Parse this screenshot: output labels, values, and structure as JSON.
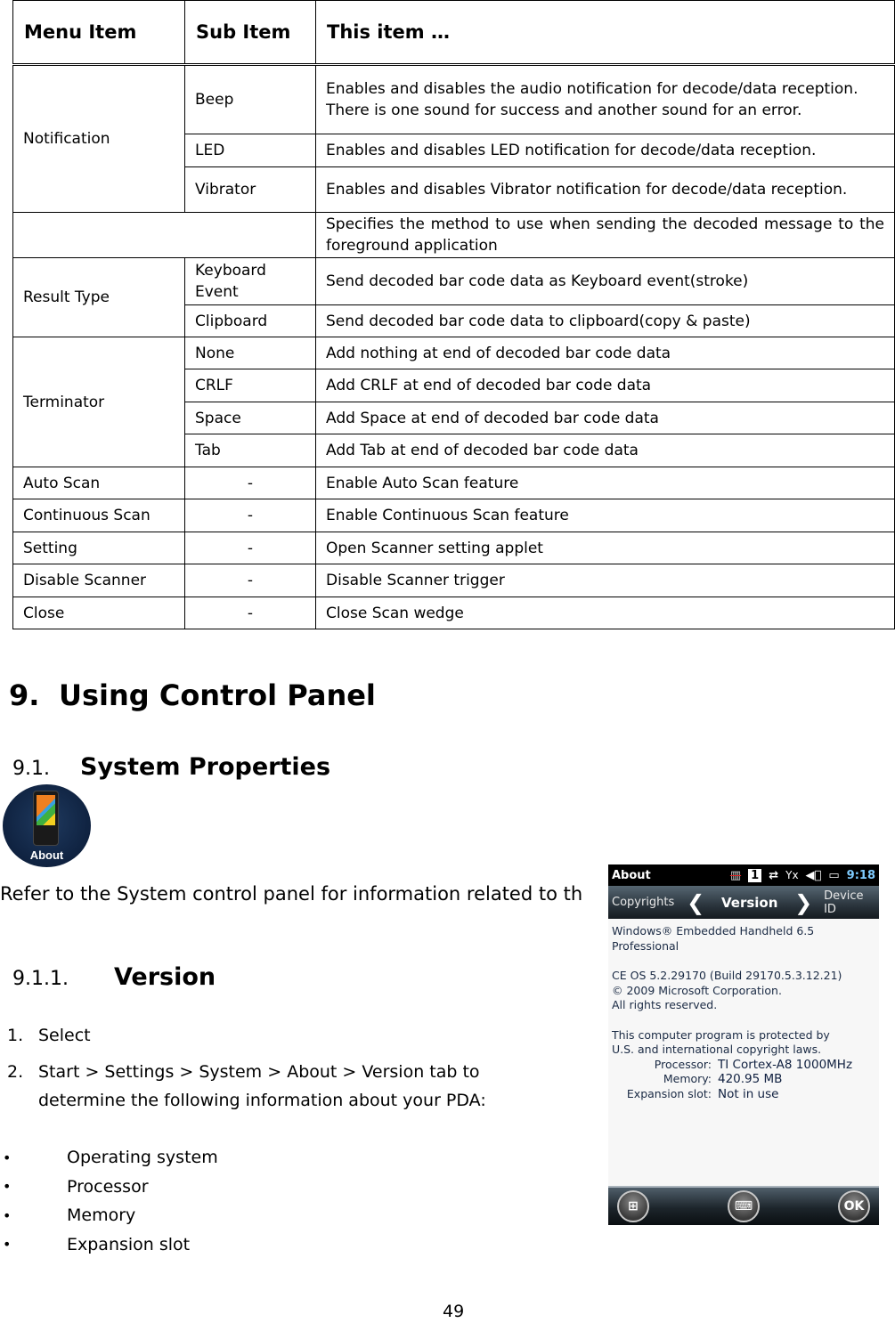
{
  "table": {
    "headers": [
      "Menu Item",
      "Sub Item",
      "This item …"
    ],
    "notification": {
      "menu": "Notification",
      "rows": [
        {
          "sub": "Beep",
          "desc": "Enables and disables the audio notification for decode/data reception. There is one sound for success and another sound for an error."
        },
        {
          "sub": "LED",
          "desc": "Enables and disables LED notification for decode/data reception."
        },
        {
          "sub": "Vibrator",
          "desc": "Enables and disables Vibrator notification for decode/data reception."
        }
      ]
    },
    "result_type_intro": "Specifies the method to use when sending the decoded message to the foreground application",
    "result_type": {
      "menu": "Result Type",
      "rows": [
        {
          "sub": "Keyboard Event",
          "desc": "Send decoded bar code data as Keyboard event(stroke)"
        },
        {
          "sub": "Clipboard",
          "desc": "Send decoded bar code data to clipboard(copy & paste)"
        }
      ]
    },
    "terminator": {
      "menu": "Terminator",
      "rows": [
        {
          "sub": "None",
          "desc": "Add nothing at end of decoded bar code data"
        },
        {
          "sub": "CRLF",
          "desc": "Add CRLF at end of decoded bar code data"
        },
        {
          "sub": "Space",
          "desc": "Add Space at end of decoded bar code data"
        },
        {
          "sub": "Tab",
          "desc": "Add Tab at end of decoded bar code data"
        }
      ]
    },
    "simple_rows": [
      {
        "menu": "Auto Scan",
        "sub": "-",
        "desc": "Enable Auto Scan feature"
      },
      {
        "menu": "Continuous Scan",
        "sub": "-",
        "desc": "Enable Continuous Scan feature"
      },
      {
        "menu": "Setting",
        "sub": "-",
        "desc": "Open Scanner setting applet"
      },
      {
        "menu": "Disable Scanner",
        "sub": "-",
        "desc": "Disable Scanner trigger"
      },
      {
        "menu": "Close",
        "sub": "-",
        "desc": "Close Scan wedge"
      }
    ]
  },
  "section": {
    "h1_num": "9.",
    "h1_title": "Using Control Panel",
    "h2_num": "9.1.",
    "h2_title": "System Properties",
    "about_icon_label": "About",
    "intro": "Refer to the System control panel for information related to th",
    "h3_num": "9.1.1.",
    "h3_title": "Version",
    "steps": [
      {
        "num": "1.",
        "text": "Select"
      },
      {
        "num": "2.",
        "text": "Start > Settings > System > About > Version tab to determine the following information about your PDA:"
      }
    ],
    "bullets": [
      "Operating system",
      "Processor",
      "Memory",
      "Expansion slot"
    ],
    "bullet_glyph": "•"
  },
  "device": {
    "status": {
      "title": "About",
      "sim_icon": "▥",
      "badge": "1",
      "sync_icon": "⇄",
      "signal_icon": "Yx",
      "volume_icon": "◀⃦",
      "battery_icon": "▭",
      "time": "9:18"
    },
    "tabs": {
      "prev": "Copyrights",
      "current": "Version",
      "next": "Device ID",
      "prev_chevron": "❮",
      "next_chevron": "❯"
    },
    "lines": {
      "product": "Windows® Embedded Handheld 6.5 Professional",
      "os": "CE OS 5.2.29170 (Build 29170.5.3.12.21)",
      "copyright": " © 2009 Microsoft Corporation.",
      "rights": "All rights reserved.",
      "protected1": "This computer program is protected by",
      "protected2": "U.S. and international copyright laws."
    },
    "info": [
      {
        "key": "Processor:",
        "value": "TI Cortex-A8 1000MHz"
      },
      {
        "key": "Memory:",
        "value": "420.95 MB"
      },
      {
        "key": "Expansion slot:",
        "value": "Not in use"
      }
    ],
    "softkeys": {
      "start": "⊞",
      "keyboard": "⌨",
      "ok": "OK"
    }
  },
  "page_number": "49"
}
